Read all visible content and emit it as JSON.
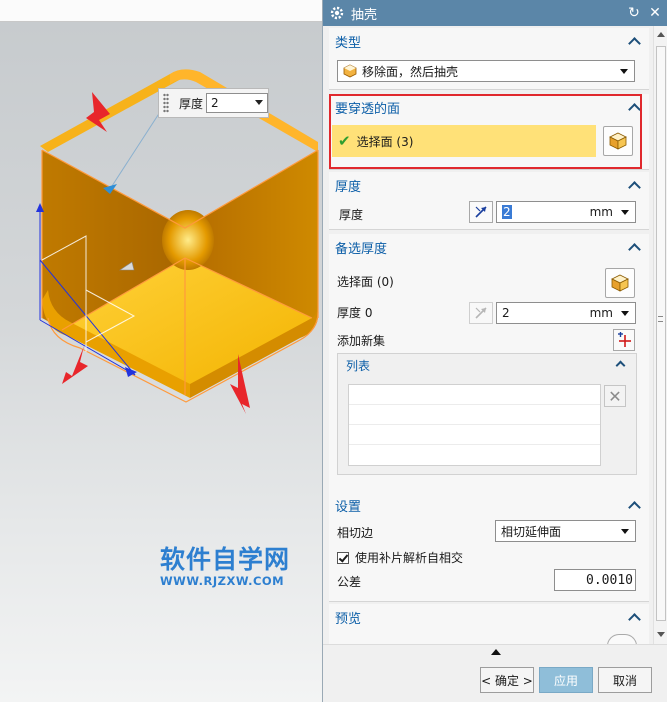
{
  "dialog": {
    "title": "抽壳",
    "sections": {
      "type": {
        "title": "类型",
        "value": "移除面，然后抽壳"
      },
      "pierce_faces": {
        "title": "要穿透的面",
        "select_label": "选择面 (3)"
      },
      "thickness": {
        "title": "厚度",
        "label": "厚度",
        "value": "2",
        "unit": "mm"
      },
      "alt_thickness": {
        "title": "备选厚度",
        "select_label": "选择面 (0)",
        "thickness_label": "厚度 0",
        "thickness_value": "2",
        "unit": "mm",
        "add_set_label": "添加新集",
        "list_title": "列表"
      },
      "settings": {
        "title": "设置",
        "tangent_label": "相切边",
        "tangent_value": "相切延伸面",
        "patch_label": "使用补片解析自相交",
        "tolerance_label": "公差",
        "tolerance_value": "0.0010"
      },
      "preview": {
        "title": "预览"
      }
    },
    "buttons": {
      "ok": "< 确定 >",
      "apply": "应用",
      "cancel": "取消"
    }
  },
  "viewport": {
    "thickness_popup": {
      "label": "厚度",
      "value": "2"
    },
    "watermark": {
      "cn": "软件自学网",
      "en": "WWW.RJZXW.COM"
    }
  },
  "colors": {
    "titlebar": "#5b86a8",
    "section_header": "#0d5fa8",
    "selected_row": "#ffe178",
    "highlight_border": "#e0282d",
    "model_orange": "#f5a800",
    "arrow_red": "#e8262b",
    "watermark": "#2d7fd0"
  }
}
